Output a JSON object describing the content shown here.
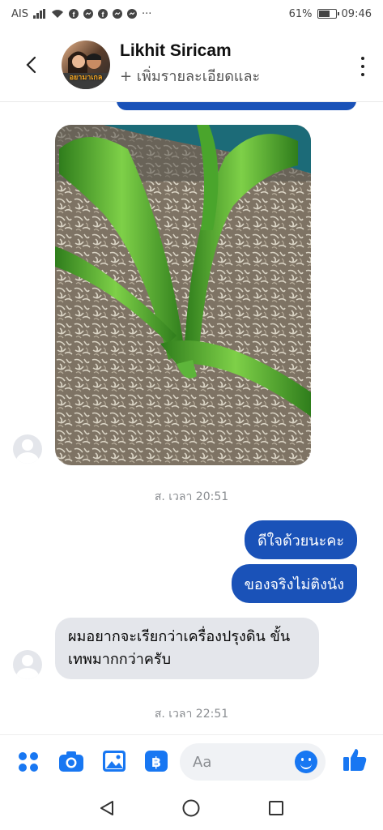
{
  "status_bar": {
    "carrier": "AIS",
    "battery": "61%",
    "battery_level": 0.61,
    "time": "09:46",
    "more": "···"
  },
  "header": {
    "contact_name": "Likhit Siricam",
    "subtitle": "+ เพิ่มรายละเอียดและ",
    "avatar_caption": "อยามาเกล",
    "back_icon": "chevron-left-icon",
    "more_icon": "more-vertical-icon"
  },
  "messages": {
    "photo_alt": "plant photo",
    "timestamp_1": "ส. เวลา 20:51",
    "outgoing": [
      "ดีใจด้วยนะคะ",
      "ของจริงไม่ติงนัง"
    ],
    "incoming_text": "ผมอยากจะเรียกว่าเครื่องปรุงดิน ขั้นเทพมากกว่าครับ",
    "timestamp_2": "ส. เวลา 22:51"
  },
  "composer": {
    "placeholder": "Aa",
    "icons": [
      "grid-menu-icon",
      "camera-icon",
      "gallery-icon",
      "payment-icon",
      "emoji-icon",
      "like-icon"
    ]
  },
  "colors": {
    "accent": "#1877f2",
    "outgoing_bubble": "#1a52b8",
    "incoming_bubble": "#e4e6eb"
  }
}
